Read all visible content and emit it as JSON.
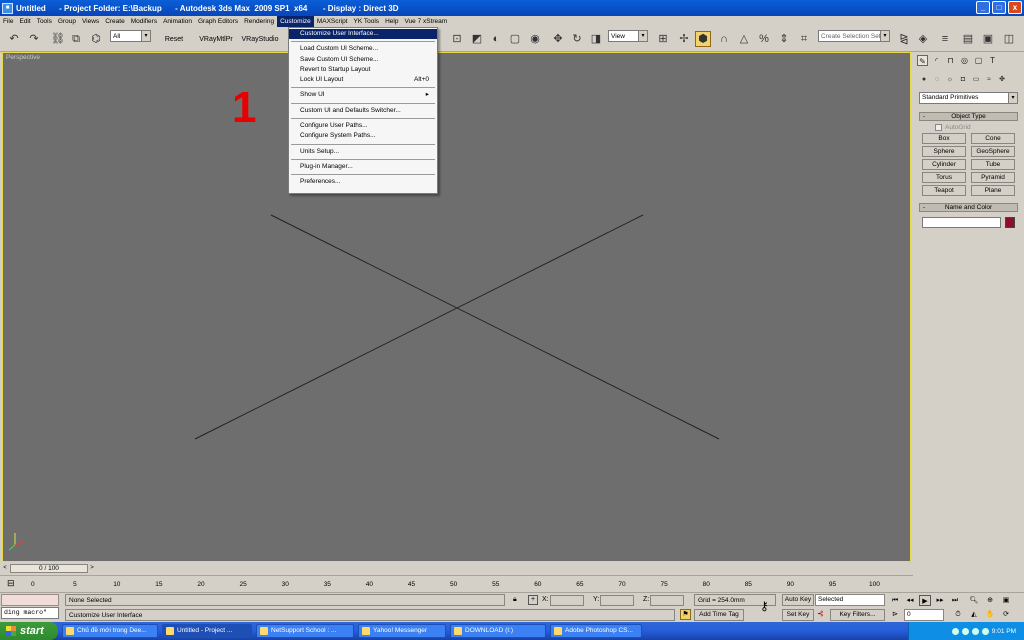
{
  "window": {
    "title": "Untitled      - Project Folder: E:\\Backup      - Autodesk 3ds Max  2009 SP1  x64       - Display : Direct 3D",
    "buttons": {
      "minimize": "_",
      "maximize": "□",
      "close": "x"
    }
  },
  "menubar": {
    "items": [
      "File",
      "Edit",
      "Tools",
      "Group",
      "Views",
      "Create",
      "Modifiers",
      "Animation",
      "Graph Editors",
      "Rendering",
      "Customize",
      "MAXScript",
      "YK Tools",
      "Help",
      "Vue 7 xStream"
    ],
    "active": "Customize"
  },
  "toolbar": {
    "selection_filter": "All",
    "reset_label": "Reset",
    "vray_mtl_label": "VRayMtlPr",
    "vray_studio_label": "VRayStudio",
    "view_combo": "View",
    "selection_set_placeholder": "Create Selection Set"
  },
  "dropdown": {
    "items": [
      {
        "label": "Customize User Interface...",
        "shortcut": ""
      },
      {
        "sep": true
      },
      {
        "label": "Load Custom UI Scheme...",
        "shortcut": ""
      },
      {
        "label": "Save Custom UI Scheme...",
        "shortcut": ""
      },
      {
        "label": "Revert to Startup Layout",
        "shortcut": ""
      },
      {
        "label": "Lock UI Layout",
        "shortcut": "Alt+0"
      },
      {
        "sep": true
      },
      {
        "label": "Show UI",
        "shortcut": "▸"
      },
      {
        "sep": true
      },
      {
        "label": "Custom UI and Defaults Switcher...",
        "shortcut": ""
      },
      {
        "sep": true
      },
      {
        "label": "Configure User Paths...",
        "shortcut": ""
      },
      {
        "label": "Configure System Paths...",
        "shortcut": ""
      },
      {
        "sep": true
      },
      {
        "label": "Units Setup...",
        "shortcut": ""
      },
      {
        "sep": true
      },
      {
        "label": "Plug-in Manager...",
        "shortcut": ""
      },
      {
        "sep": true
      },
      {
        "label": "Preferences...",
        "shortcut": ""
      }
    ]
  },
  "viewport": {
    "label": "Perspective",
    "annotation": "1",
    "background": "#6e6e6e",
    "border_color": "#e8d84a"
  },
  "command_panel": {
    "category": "Standard Primitives",
    "object_type_header": "Object Type",
    "autogrid": "AutoGrid",
    "buttons": [
      "Box",
      "Cone",
      "Sphere",
      "GeoSphere",
      "Cylinder",
      "Tube",
      "Torus",
      "Pyramid",
      "Teapot",
      "Plane"
    ],
    "name_color_header": "Name and Color",
    "object_color": "#8b1030"
  },
  "timeline": {
    "slider_label": "0 / 100",
    "ticks": [
      "0",
      "5",
      "10",
      "15",
      "20",
      "25",
      "30",
      "35",
      "40",
      "45",
      "50",
      "55",
      "60",
      "65",
      "70",
      "75",
      "80",
      "85",
      "90",
      "95",
      "100"
    ]
  },
  "status": {
    "maxscript_text": "ding macro\"",
    "selection": "None Selected",
    "prompt": "Customize User Interface",
    "x_label": "X:",
    "y_label": "Y:",
    "z_label": "Z:",
    "grid": "Grid = 254.0mm",
    "add_time_tag": "Add Time Tag",
    "auto_key": "Auto Key",
    "set_key": "Set Key",
    "key_mode": "Selected",
    "key_filters": "Key Filters...",
    "frame": "0"
  },
  "taskbar": {
    "start": "start",
    "tasks": [
      "Chủ đề mới trong Dee...",
      "Untitled     - Project ...",
      "NetSupport School : ...",
      "Yahoo! Messenger",
      "DOWNLOAD (I:)",
      "Adobe Photoshop CS..."
    ],
    "active_index": 1,
    "clock": "9:01 PM"
  }
}
